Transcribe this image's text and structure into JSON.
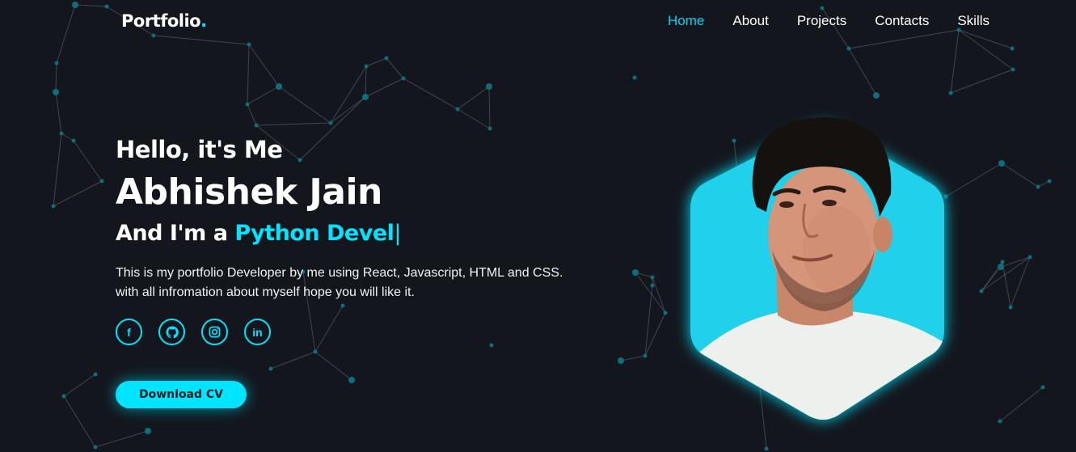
{
  "brand": {
    "name": "Portfolio",
    "dot": ".",
    "accent": "#00e5ff"
  },
  "nav": {
    "items": [
      {
        "label": "Home",
        "active": true
      },
      {
        "label": "About",
        "active": false
      },
      {
        "label": "Projects",
        "active": false
      },
      {
        "label": "Contacts",
        "active": false
      },
      {
        "label": "Skills",
        "active": false
      }
    ]
  },
  "hero": {
    "greeting": "Hello, it's Me",
    "name": "Abhishek Jain",
    "role_prefix": "And I'm a ",
    "role_typed": "Python Devel",
    "cursor": "|",
    "description_line1": "This is my portfolio Developer by me using React, Javascript, HTML and CSS.",
    "description_line2": "with all infromation about myself hope you will like it.",
    "cta_label": "Download CV"
  },
  "socials": [
    {
      "icon": "facebook-icon",
      "glyph": "f"
    },
    {
      "icon": "github-icon",
      "glyph": ""
    },
    {
      "icon": "instagram-icon",
      "glyph": ""
    },
    {
      "icon": "linkedin-icon",
      "glyph": "in"
    }
  ],
  "colors": {
    "background": "#13161d",
    "accent": "#00e5ff",
    "nav_active": "#00d5f5"
  }
}
